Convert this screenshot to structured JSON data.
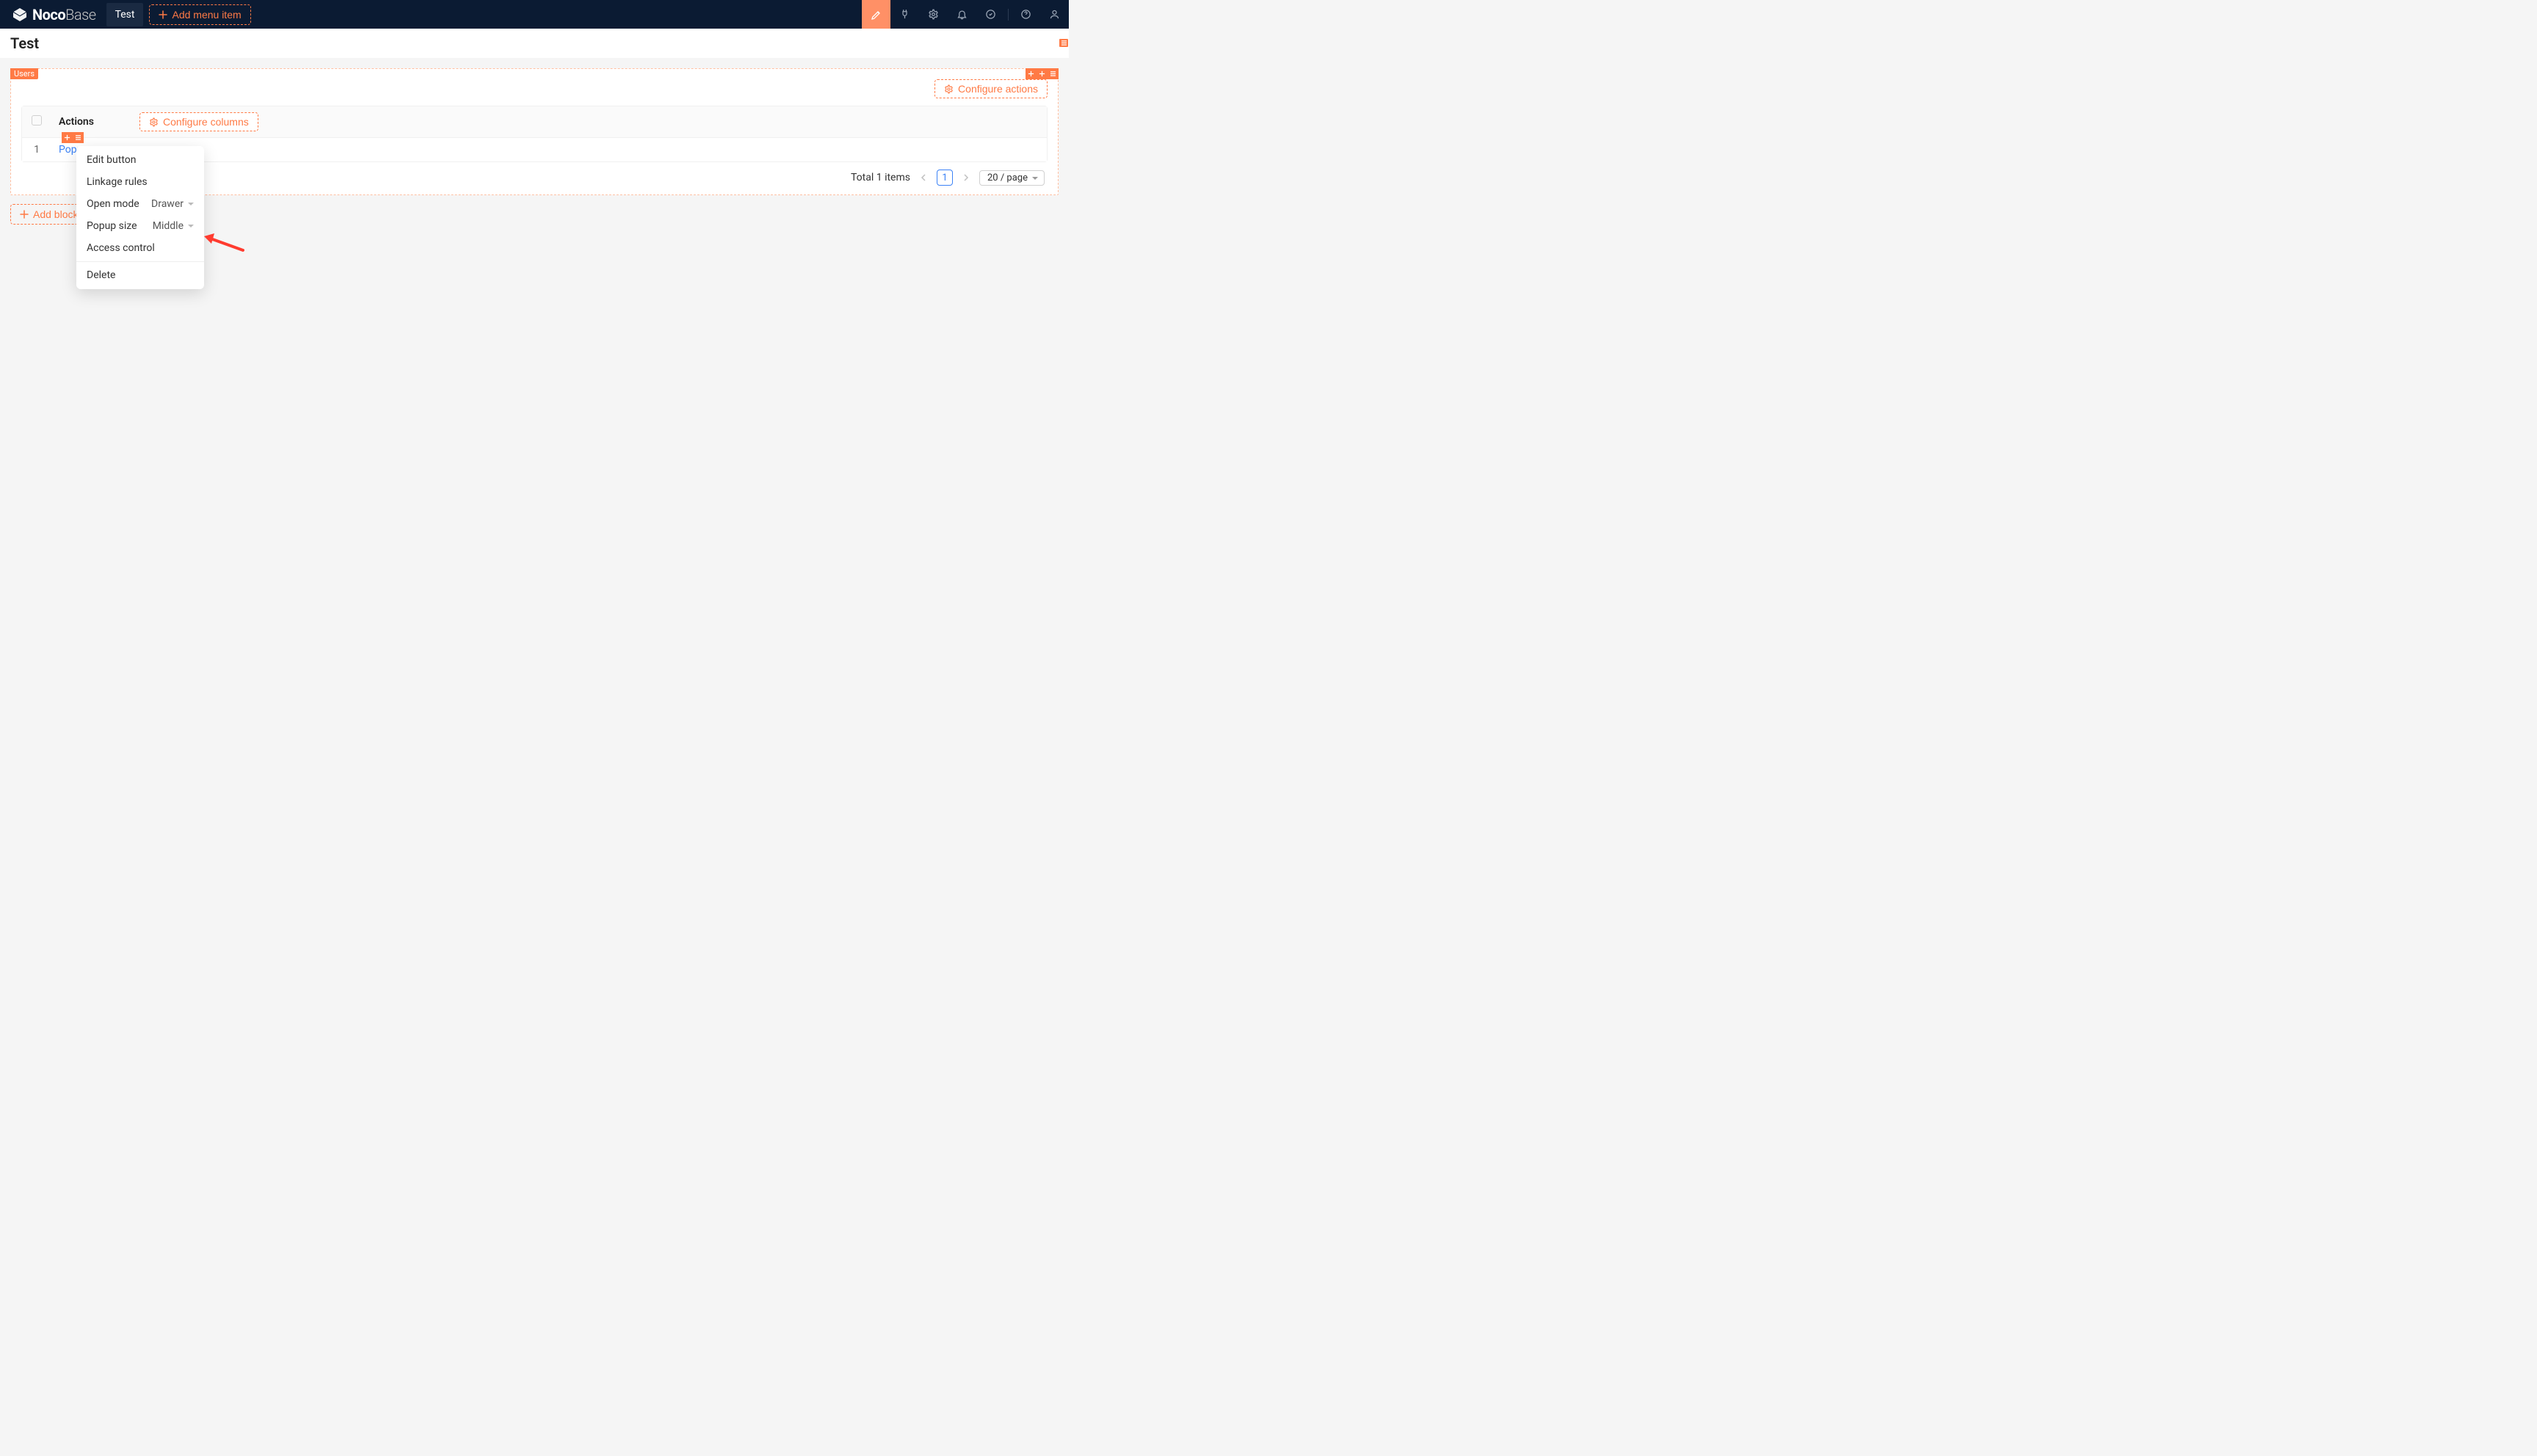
{
  "brand": {
    "name1": "Noco",
    "name2": "Base"
  },
  "nav": {
    "active_tab": "Test",
    "add_menu_item": "Add menu item"
  },
  "page": {
    "title": "Test"
  },
  "block": {
    "tag": "Users",
    "configure_actions": "Configure actions",
    "configure_columns": "Configure columns",
    "columns": {
      "actions": "Actions"
    },
    "rows": [
      {
        "index": "1",
        "action_label": "Popup"
      }
    ],
    "pagination": {
      "total_text": "Total 1 items",
      "current_page": "1",
      "page_size_label": "20 / page"
    }
  },
  "add_block": "Add block",
  "context_menu": {
    "edit_button": "Edit button",
    "linkage_rules": "Linkage rules",
    "open_mode_label": "Open mode",
    "open_mode_value": "Drawer",
    "popup_size_label": "Popup size",
    "popup_size_value": "Middle",
    "access_control": "Access control",
    "delete": "Delete"
  }
}
